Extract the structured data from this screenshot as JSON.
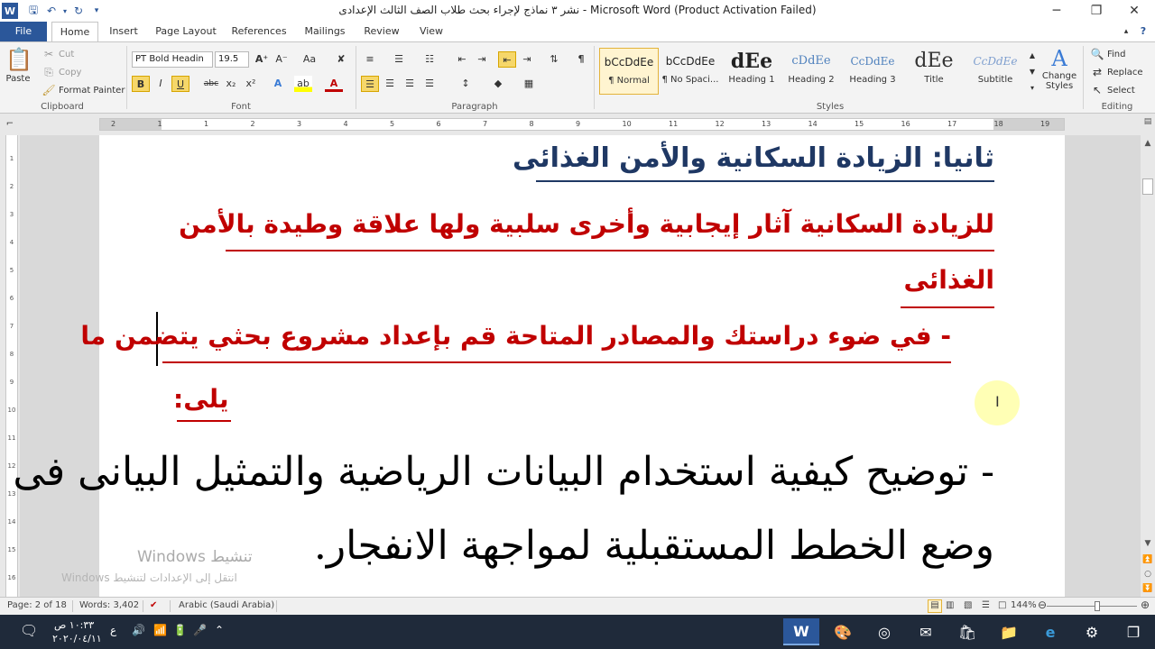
{
  "title_bar": {
    "title": "نشر ٣ نماذج لإجراء بحث طلاب الصف الثالث الإعدادى - Microsoft Word (Product Activation Failed)",
    "app_icon": "W",
    "qat_icons": [
      "save-icon",
      "undo-icon",
      "redo-icon",
      "customize-icon"
    ],
    "controls": {
      "minimize": "─",
      "restore": "❐",
      "close": "✕"
    }
  },
  "tabs": [
    "File",
    "Home",
    "Insert",
    "Page Layout",
    "References",
    "Mailings",
    "Review",
    "View"
  ],
  "ribbon": {
    "clipboard": {
      "paste": "Paste",
      "cut": "Cut",
      "copy": "Copy",
      "format_painter": "Format Painter",
      "label": "Clipboard"
    },
    "font": {
      "name": "PT Bold Headin",
      "size": "19.5",
      "label": "Font",
      "bold": "B",
      "italic": "I",
      "underline": "U",
      "strike": "abc",
      "sub": "x₂",
      "sup": "x²"
    },
    "paragraph": {
      "label": "Paragraph",
      "pilcrow": "¶"
    },
    "styles": {
      "label": "Styles",
      "items": [
        {
          "sample": "bCcDdEe",
          "name": "¶ Normal"
        },
        {
          "sample": "bCcDdEe",
          "name": "¶ No Spaci..."
        },
        {
          "sample": "dEe",
          "name": "Heading 1"
        },
        {
          "sample": "cDdEe",
          "name": "Heading 2"
        },
        {
          "sample": "CcDdEe",
          "name": "Heading 3"
        },
        {
          "sample": "dEe",
          "name": "Title"
        },
        {
          "sample": "CcDdEe",
          "name": "Subtitle"
        }
      ],
      "change_styles": "Change Styles"
    },
    "editing": {
      "label": "Editing",
      "find": "Find",
      "replace": "Replace",
      "select": "Select"
    }
  },
  "ruler": {
    "numbers": [
      "2",
      "1",
      "1",
      "2",
      "3",
      "4",
      "5",
      "6",
      "7",
      "8",
      "9",
      "10",
      "11",
      "12",
      "13",
      "14",
      "15",
      "16",
      "17",
      "18",
      "19"
    ]
  },
  "vruler": {
    "numbers": [
      "1",
      "2",
      "3",
      "4",
      "5",
      "6",
      "7",
      "8",
      "9",
      "10",
      "11",
      "12",
      "13",
      "14",
      "15",
      "16"
    ]
  },
  "document": {
    "heading": "ثانيا: الزيادة السكانية والأمن الغذائى",
    "para1_line1": "للزيادة السكانية آثار إيجابية وأخرى سلبية ولها علاقة وطيدة بالأمن",
    "para1_line2": "الغذائى",
    "para2_line1": "- في ضوء دراستك والمصادر المتاحة قم بإعداد مشروع بحثي يتضمن ما",
    "para2_line2": "يلى:",
    "para3_line1": "- توضيح كيفية استخدام البيانات الرياضية والتمثيل البيانى فى",
    "para3_line2": "وضع الخطط المستقبلية لمواجهة الانفجار."
  },
  "watermark": {
    "title": "تنشيط Windows",
    "subtitle": "انتقل إلى الإعدادات لتنشيط Windows"
  },
  "status_bar": {
    "page": "Page: 2 of 18",
    "words": "Words: 3,402",
    "language": "Arabic (Saudi Arabia)",
    "zoom": "144%",
    "zoom_fraction": 0.56
  },
  "taskbar": {
    "time": "١٠:٣٣ ص",
    "date": "٢٠٢٠/٠٤/١١",
    "lang": "ع",
    "apps": [
      "word-icon",
      "paint-icon",
      "chrome-icon",
      "mail-icon",
      "store-icon",
      "explorer-icon",
      "edge-icon",
      "settings-icon",
      "task-view-icon"
    ]
  }
}
